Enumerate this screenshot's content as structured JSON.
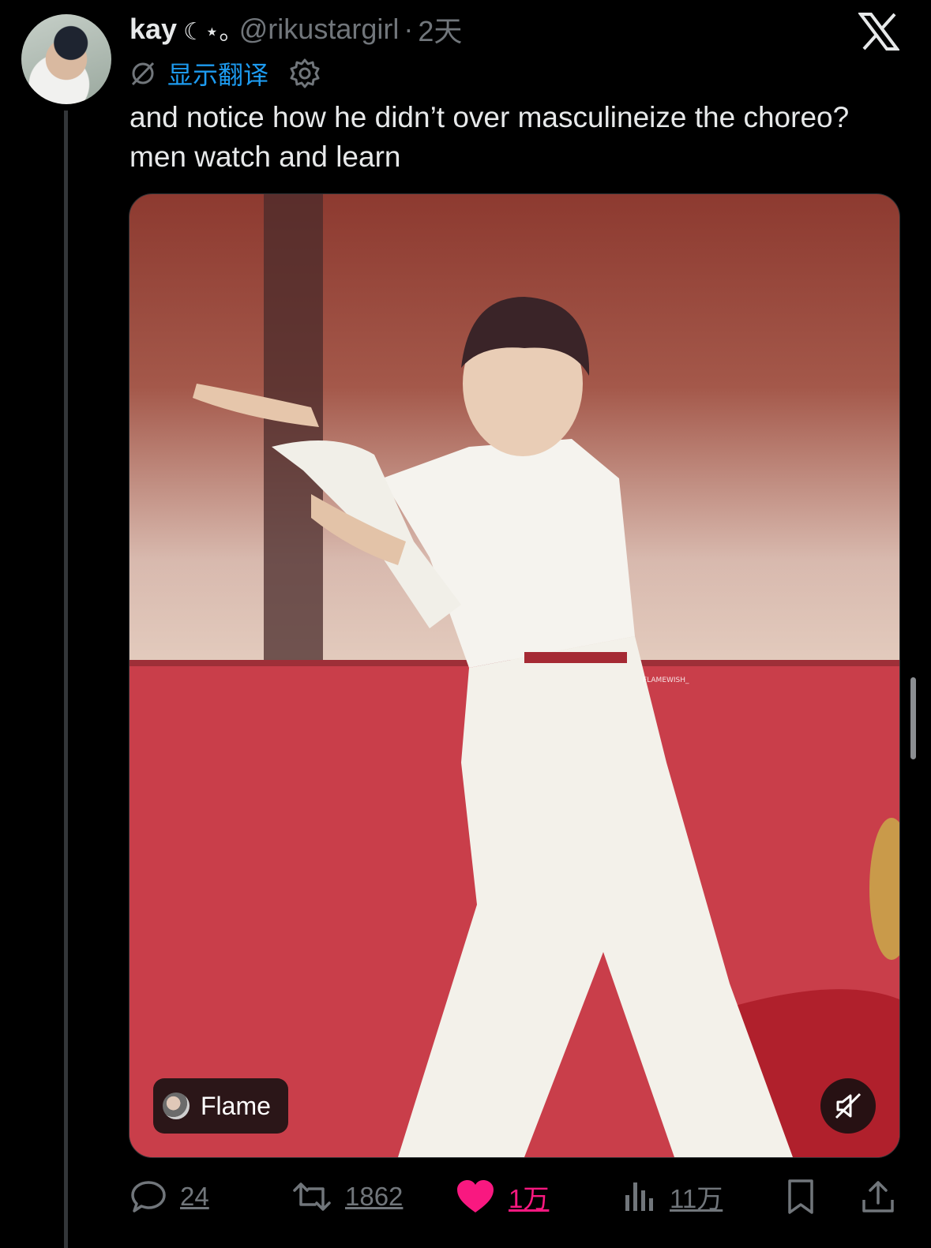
{
  "author": {
    "name": "kay",
    "decoration": "☾⋆｡",
    "handle": "@rikustargirl",
    "separator": "·",
    "time": "2天"
  },
  "translate": {
    "label": "显示翻译"
  },
  "tweet": {
    "text": "and notice how he didn’t over masculineize the choreo? men watch and learn"
  },
  "media": {
    "source_label": "Flame",
    "watermark": "FLAMEWISH_"
  },
  "actions": {
    "replies": "24",
    "reposts": "1862",
    "likes": "1万",
    "views": "11万"
  },
  "colors": {
    "background": "#000000",
    "text": "#e7e9ea",
    "secondary": "#71767b",
    "link": "#1d9bf0",
    "like": "#f91880"
  },
  "icons": [
    "x-logo-icon",
    "translate-icon",
    "gear-icon",
    "mute-icon",
    "reply-icon",
    "repost-icon",
    "like-icon",
    "views-icon",
    "bookmark-icon",
    "share-icon"
  ]
}
